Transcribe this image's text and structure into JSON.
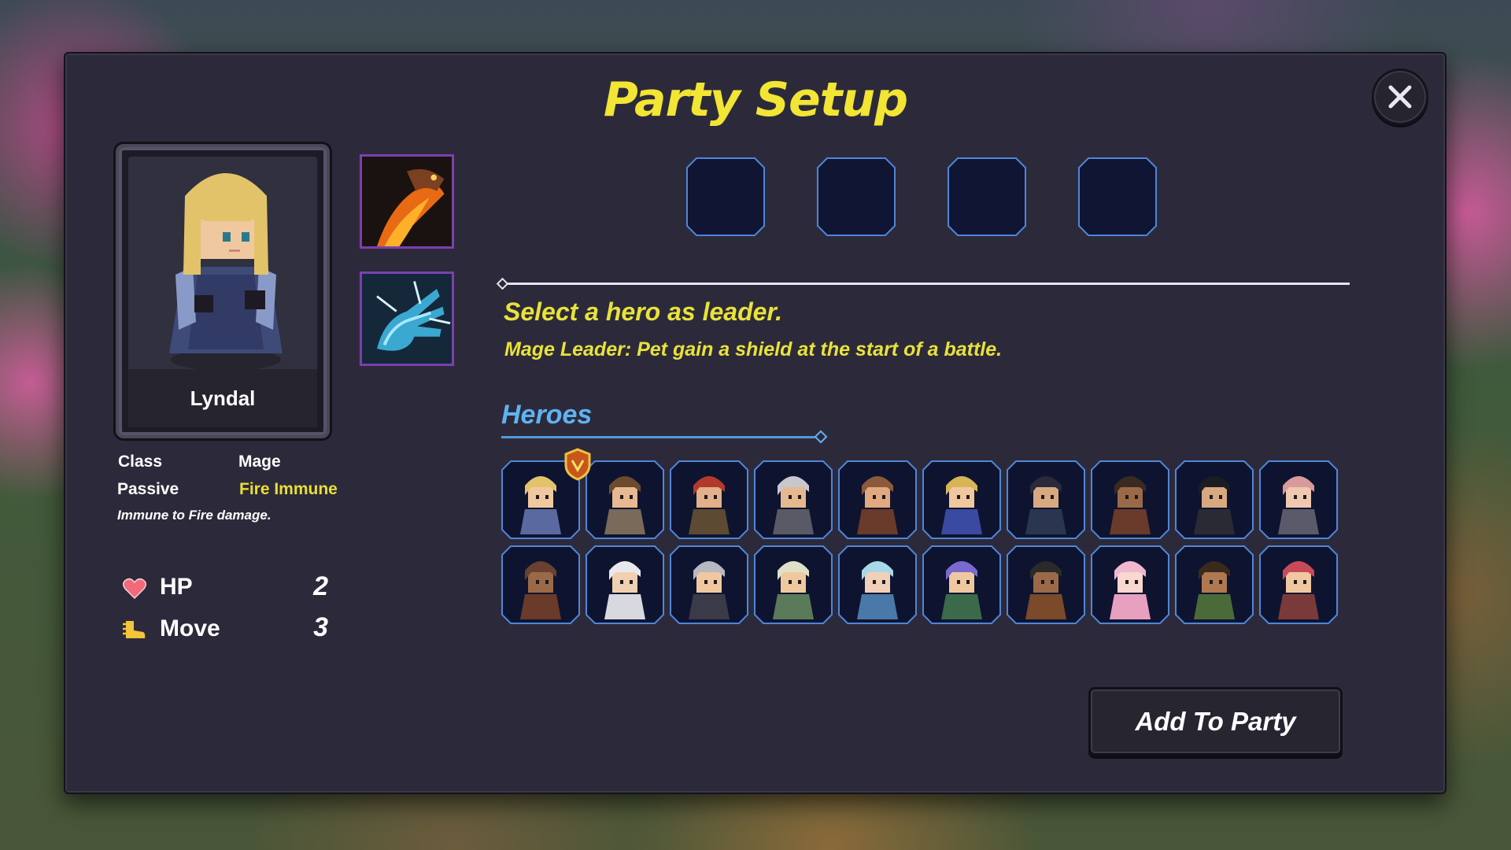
{
  "title": "Party Setup",
  "close_icon": "close-icon",
  "selected_hero": {
    "name": "Lyndal",
    "class_label": "Class",
    "class_value": "Mage",
    "passive_label": "Passive",
    "passive_value": "Fire Immune",
    "passive_desc": "Immune to Fire damage.",
    "stats": [
      {
        "icon": "heart-icon",
        "label": "HP",
        "value": "2"
      },
      {
        "icon": "boot-icon",
        "label": "Move",
        "value": "3"
      }
    ],
    "abilities": [
      "dragon-breath-icon",
      "ice-hand-icon"
    ]
  },
  "party_slots": 4,
  "leader_prompt": "Select a hero as leader.",
  "leader_desc": "Mage Leader: Pet gain a shield at the start of a battle.",
  "heroes_title": "Heroes",
  "heroes": [
    {
      "hair": "#e2c36a",
      "skin": "#f0c8a0",
      "outfit": "#5a6aa0"
    },
    {
      "hair": "#6b4a2e",
      "skin": "#e8b890",
      "outfit": "#7a6a5a"
    },
    {
      "hair": "#b23a2a",
      "skin": "#e2b08a",
      "outfit": "#5c4a32"
    },
    {
      "hair": "#c8c8cc",
      "skin": "#e6b890",
      "outfit": "#5a5a66"
    },
    {
      "hair": "#8a5a3a",
      "skin": "#e2a880",
      "outfit": "#6a3a2a"
    },
    {
      "hair": "#d8b456",
      "skin": "#f0c8a0",
      "outfit": "#3a4aa0"
    },
    {
      "hair": "#2a2a3a",
      "skin": "#d8a880",
      "outfit": "#2a3550"
    },
    {
      "hair": "#3a2a22",
      "skin": "#9a6a48",
      "outfit": "#6a3a2a"
    },
    {
      "hair": "#1c1c24",
      "skin": "#d8a880",
      "outfit": "#2a2a34"
    },
    {
      "hair": "#d89a9a",
      "skin": "#f0c8b0",
      "outfit": "#5a5a6a"
    },
    {
      "hair": "#6a4030",
      "skin": "#9a6a48",
      "outfit": "#6a3a2a"
    },
    {
      "hair": "#e8e8ec",
      "skin": "#f0d0b0",
      "outfit": "#d8d8e0"
    },
    {
      "hair": "#b8b8c0",
      "skin": "#f0c8a0",
      "outfit": "#3a3a48"
    },
    {
      "hair": "#e0e0c8",
      "skin": "#f0c8a0",
      "outfit": "#5a7a5a"
    },
    {
      "hair": "#a8d8e8",
      "skin": "#f0d0b8",
      "outfit": "#4a78a8"
    },
    {
      "hair": "#7a6ad0",
      "skin": "#f0c8a0",
      "outfit": "#3a6a4a"
    },
    {
      "hair": "#2a2a2a",
      "skin": "#9a6a48",
      "outfit": "#7a4a2a"
    },
    {
      "hair": "#f0b8d0",
      "skin": "#f8d8d0",
      "outfit": "#e8a0c0"
    },
    {
      "hair": "#3a2a1a",
      "skin": "#b07850",
      "outfit": "#4a6a3a"
    },
    {
      "hair": "#c84a5a",
      "skin": "#f0c8a0",
      "outfit": "#7a3a3a"
    }
  ],
  "add_button": "Add To Party",
  "colors": {
    "accent_yellow": "#f2e534",
    "heroes_blue": "#5fb2f2",
    "passive_yellow": "#e9de36",
    "panel": "#2c2a3a"
  }
}
